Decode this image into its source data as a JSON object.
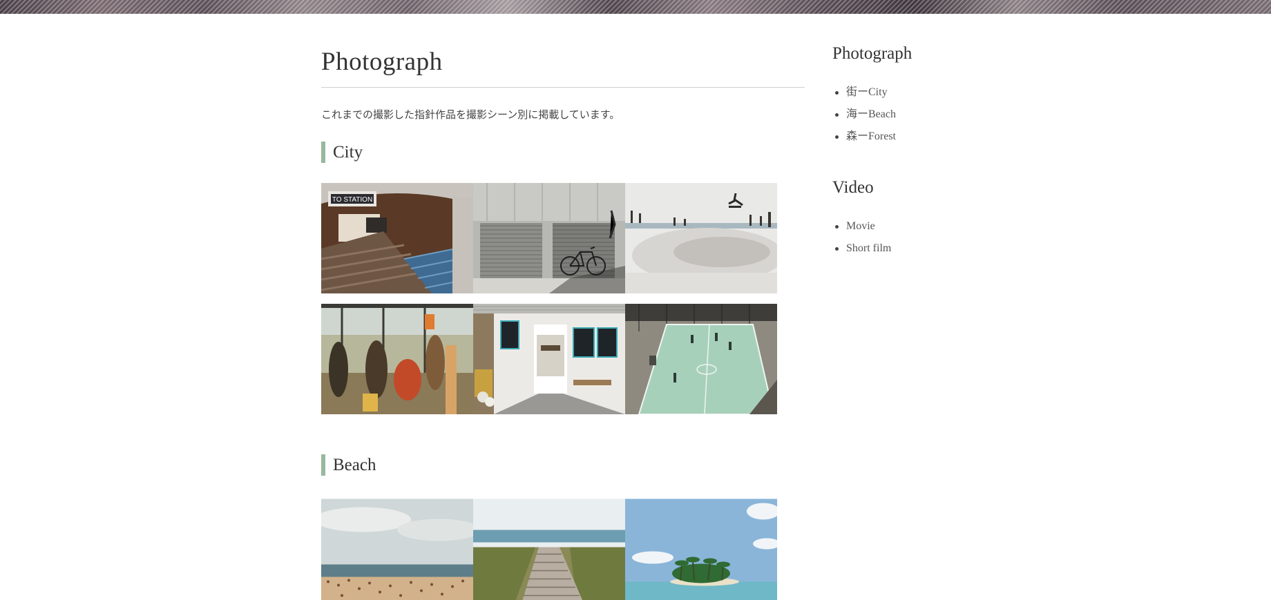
{
  "main": {
    "title": "Photograph",
    "intro": "これまでの撮影した指針作品を撮影シーン別に掲載しています。",
    "sections": [
      {
        "title": "City",
        "photos": [
          {
            "subject": "subway stairs",
            "sign": "TO STATION"
          },
          {
            "subject": "bicycle by shutters"
          },
          {
            "subject": "skatepark"
          },
          {
            "subject": "airport travelers"
          },
          {
            "subject": "shop corridor"
          },
          {
            "subject": "basketball court"
          }
        ]
      },
      {
        "title": "Beach",
        "photos": [
          {
            "subject": "crowded beach"
          },
          {
            "subject": "boardwalk to sea"
          },
          {
            "subject": "palm island"
          }
        ]
      }
    ]
  },
  "sidebar": {
    "sections": [
      {
        "heading": "Photograph",
        "items": [
          "街ーCity",
          "海ーBeach",
          "森ーForest"
        ]
      },
      {
        "heading": "Video",
        "items": [
          "Movie",
          "Short film"
        ]
      }
    ]
  },
  "colors": {
    "accent": "#98b8a0",
    "text": "#333333",
    "rule": "#cfcfcf"
  }
}
